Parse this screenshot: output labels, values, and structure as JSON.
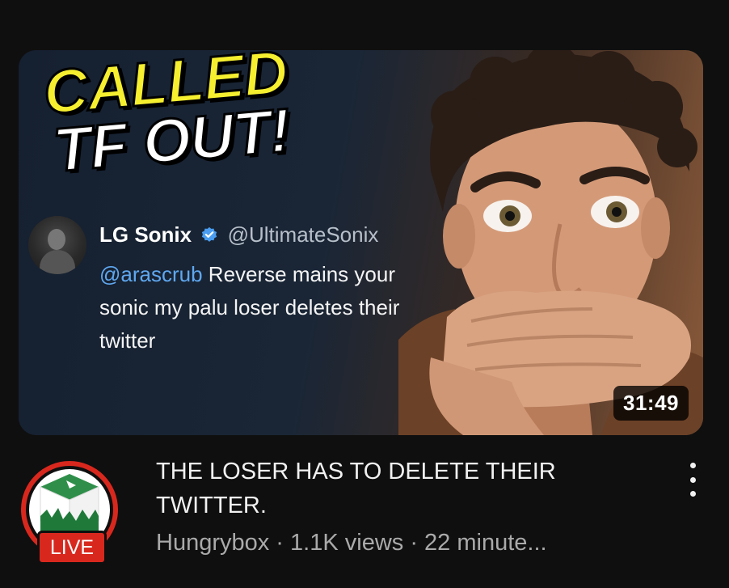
{
  "thumbnail": {
    "headline_line1": "CALLED",
    "headline_line2": "TF OUT!",
    "tweet": {
      "name": "LG Sonix",
      "handle": "@UltimateSonix",
      "mention": "@arascrub",
      "text_after_mention": " Reverse mains your sonic my palu loser deletes their twitter"
    },
    "duration": "31:49"
  },
  "video": {
    "title": "THE LOSER HAS TO DELETE THEIR TWITTER.",
    "channel": "Hungrybox",
    "views": "1.1K views",
    "age": "22 minute..."
  },
  "channel_avatar": {
    "live_label": "LIVE"
  },
  "menu": {
    "icon": "more-vert-icon"
  },
  "colors": {
    "background": "#0f0f0f",
    "live_red": "#d8281e",
    "headline_yellow": "#f5ef30",
    "mention_blue": "#5fa8f0",
    "meta_gray": "#aaaaaa"
  }
}
